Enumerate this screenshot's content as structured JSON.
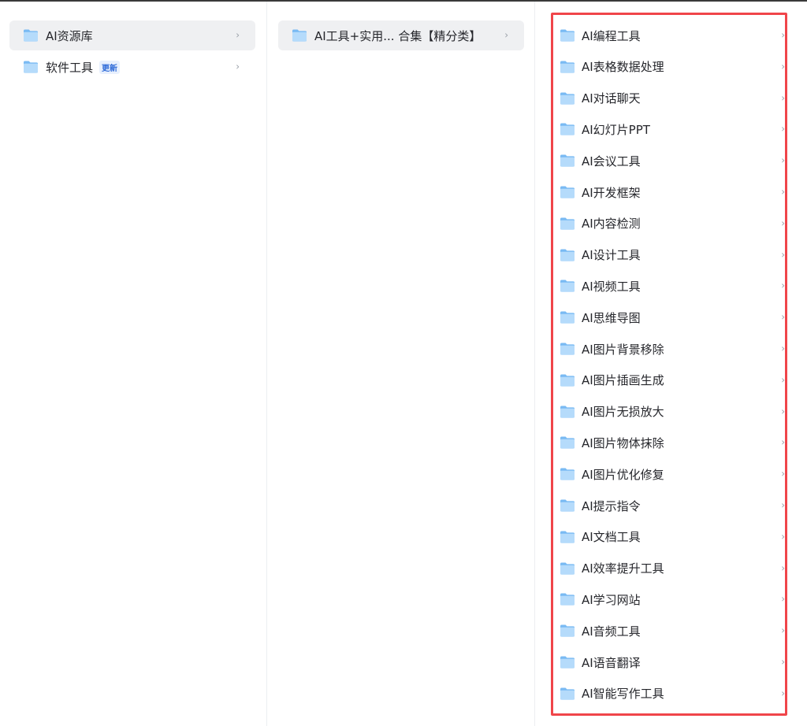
{
  "column1": {
    "items": [
      {
        "label": "AI资源库",
        "badge": "",
        "selected": true
      },
      {
        "label": "软件工具",
        "badge": "更新",
        "selected": false
      }
    ]
  },
  "column2": {
    "items": [
      {
        "label": "AI工具+实用... 合集【精分类】",
        "selected": true
      }
    ]
  },
  "column3": {
    "items": [
      {
        "label": "AI编程工具"
      },
      {
        "label": "AI表格数据处理"
      },
      {
        "label": "AI对话聊天"
      },
      {
        "label": "AI幻灯片PPT"
      },
      {
        "label": "AI会议工具"
      },
      {
        "label": "AI开发框架"
      },
      {
        "label": "AI内容检测"
      },
      {
        "label": "AI设计工具"
      },
      {
        "label": "AI视频工具"
      },
      {
        "label": "AI思维导图"
      },
      {
        "label": "AI图片背景移除"
      },
      {
        "label": "AI图片插画生成"
      },
      {
        "label": "AI图片无损放大"
      },
      {
        "label": "AI图片物体抹除"
      },
      {
        "label": "AI图片优化修复"
      },
      {
        "label": "AI提示指令"
      },
      {
        "label": "AI文档工具"
      },
      {
        "label": "AI效率提升工具"
      },
      {
        "label": "AI学习网站"
      },
      {
        "label": "AI音频工具"
      },
      {
        "label": "AI语音翻译"
      },
      {
        "label": "AI智能写作工具"
      }
    ]
  },
  "chevron_glyph": "›",
  "icons": {
    "folder": "folder-icon",
    "chevron": "chevron-right-icon"
  },
  "colors": {
    "folder_light": "#b8dcfb",
    "folder_dark": "#6fb3f1",
    "highlight": "#f0454a",
    "selected_bg": "#eff0f2"
  }
}
